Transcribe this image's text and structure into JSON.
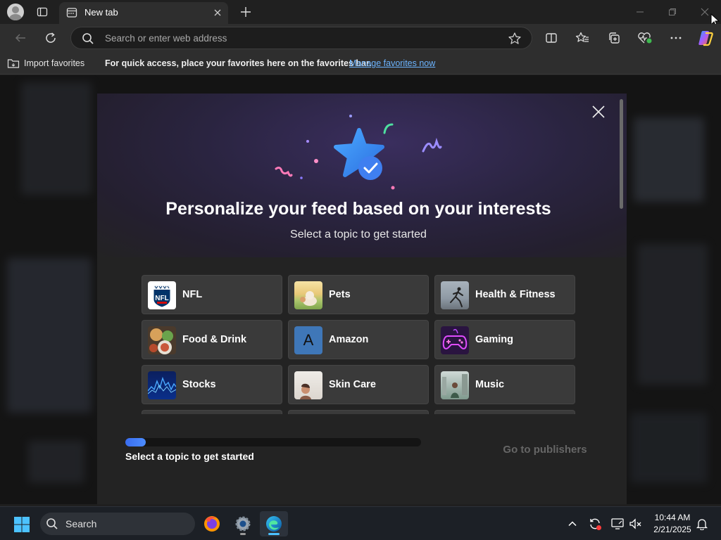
{
  "browser": {
    "tab_title": "New tab",
    "address_placeholder": "Search or enter web address"
  },
  "favorites_bar": {
    "import_label": "Import favorites",
    "message": "For quick access, place your favorites here on the favorites bar.",
    "manage_link": "Manage favorites now"
  },
  "dialog": {
    "title": "Personalize your feed based on your interests",
    "subtitle": "Select a topic to get started",
    "topics": [
      {
        "label": "NFL",
        "icon": "nfl-logo"
      },
      {
        "label": "Pets",
        "icon": "pets-photo"
      },
      {
        "label": "Health & Fitness",
        "icon": "fitness-photo"
      },
      {
        "label": "Food & Drink",
        "icon": "food-photo"
      },
      {
        "label": "Amazon",
        "icon": "amazon-letter"
      },
      {
        "label": "Gaming",
        "icon": "gamepad-neon"
      },
      {
        "label": "Stocks",
        "icon": "stocks-chart"
      },
      {
        "label": "Skin Care",
        "icon": "skincare-photo"
      },
      {
        "label": "Music",
        "icon": "music-photo"
      }
    ],
    "amazon_letter": "A",
    "progress_fraction": 0.07,
    "progress_label": "Select a topic to get started",
    "go_button": "Go to publishers"
  },
  "taskbar": {
    "search_label": "Search",
    "time": "10:44 AM",
    "date": "2/21/2025"
  },
  "colors": {
    "accent": "#4c8dff",
    "link": "#6cb4ff",
    "active_indicator": "#4cc2ff"
  }
}
